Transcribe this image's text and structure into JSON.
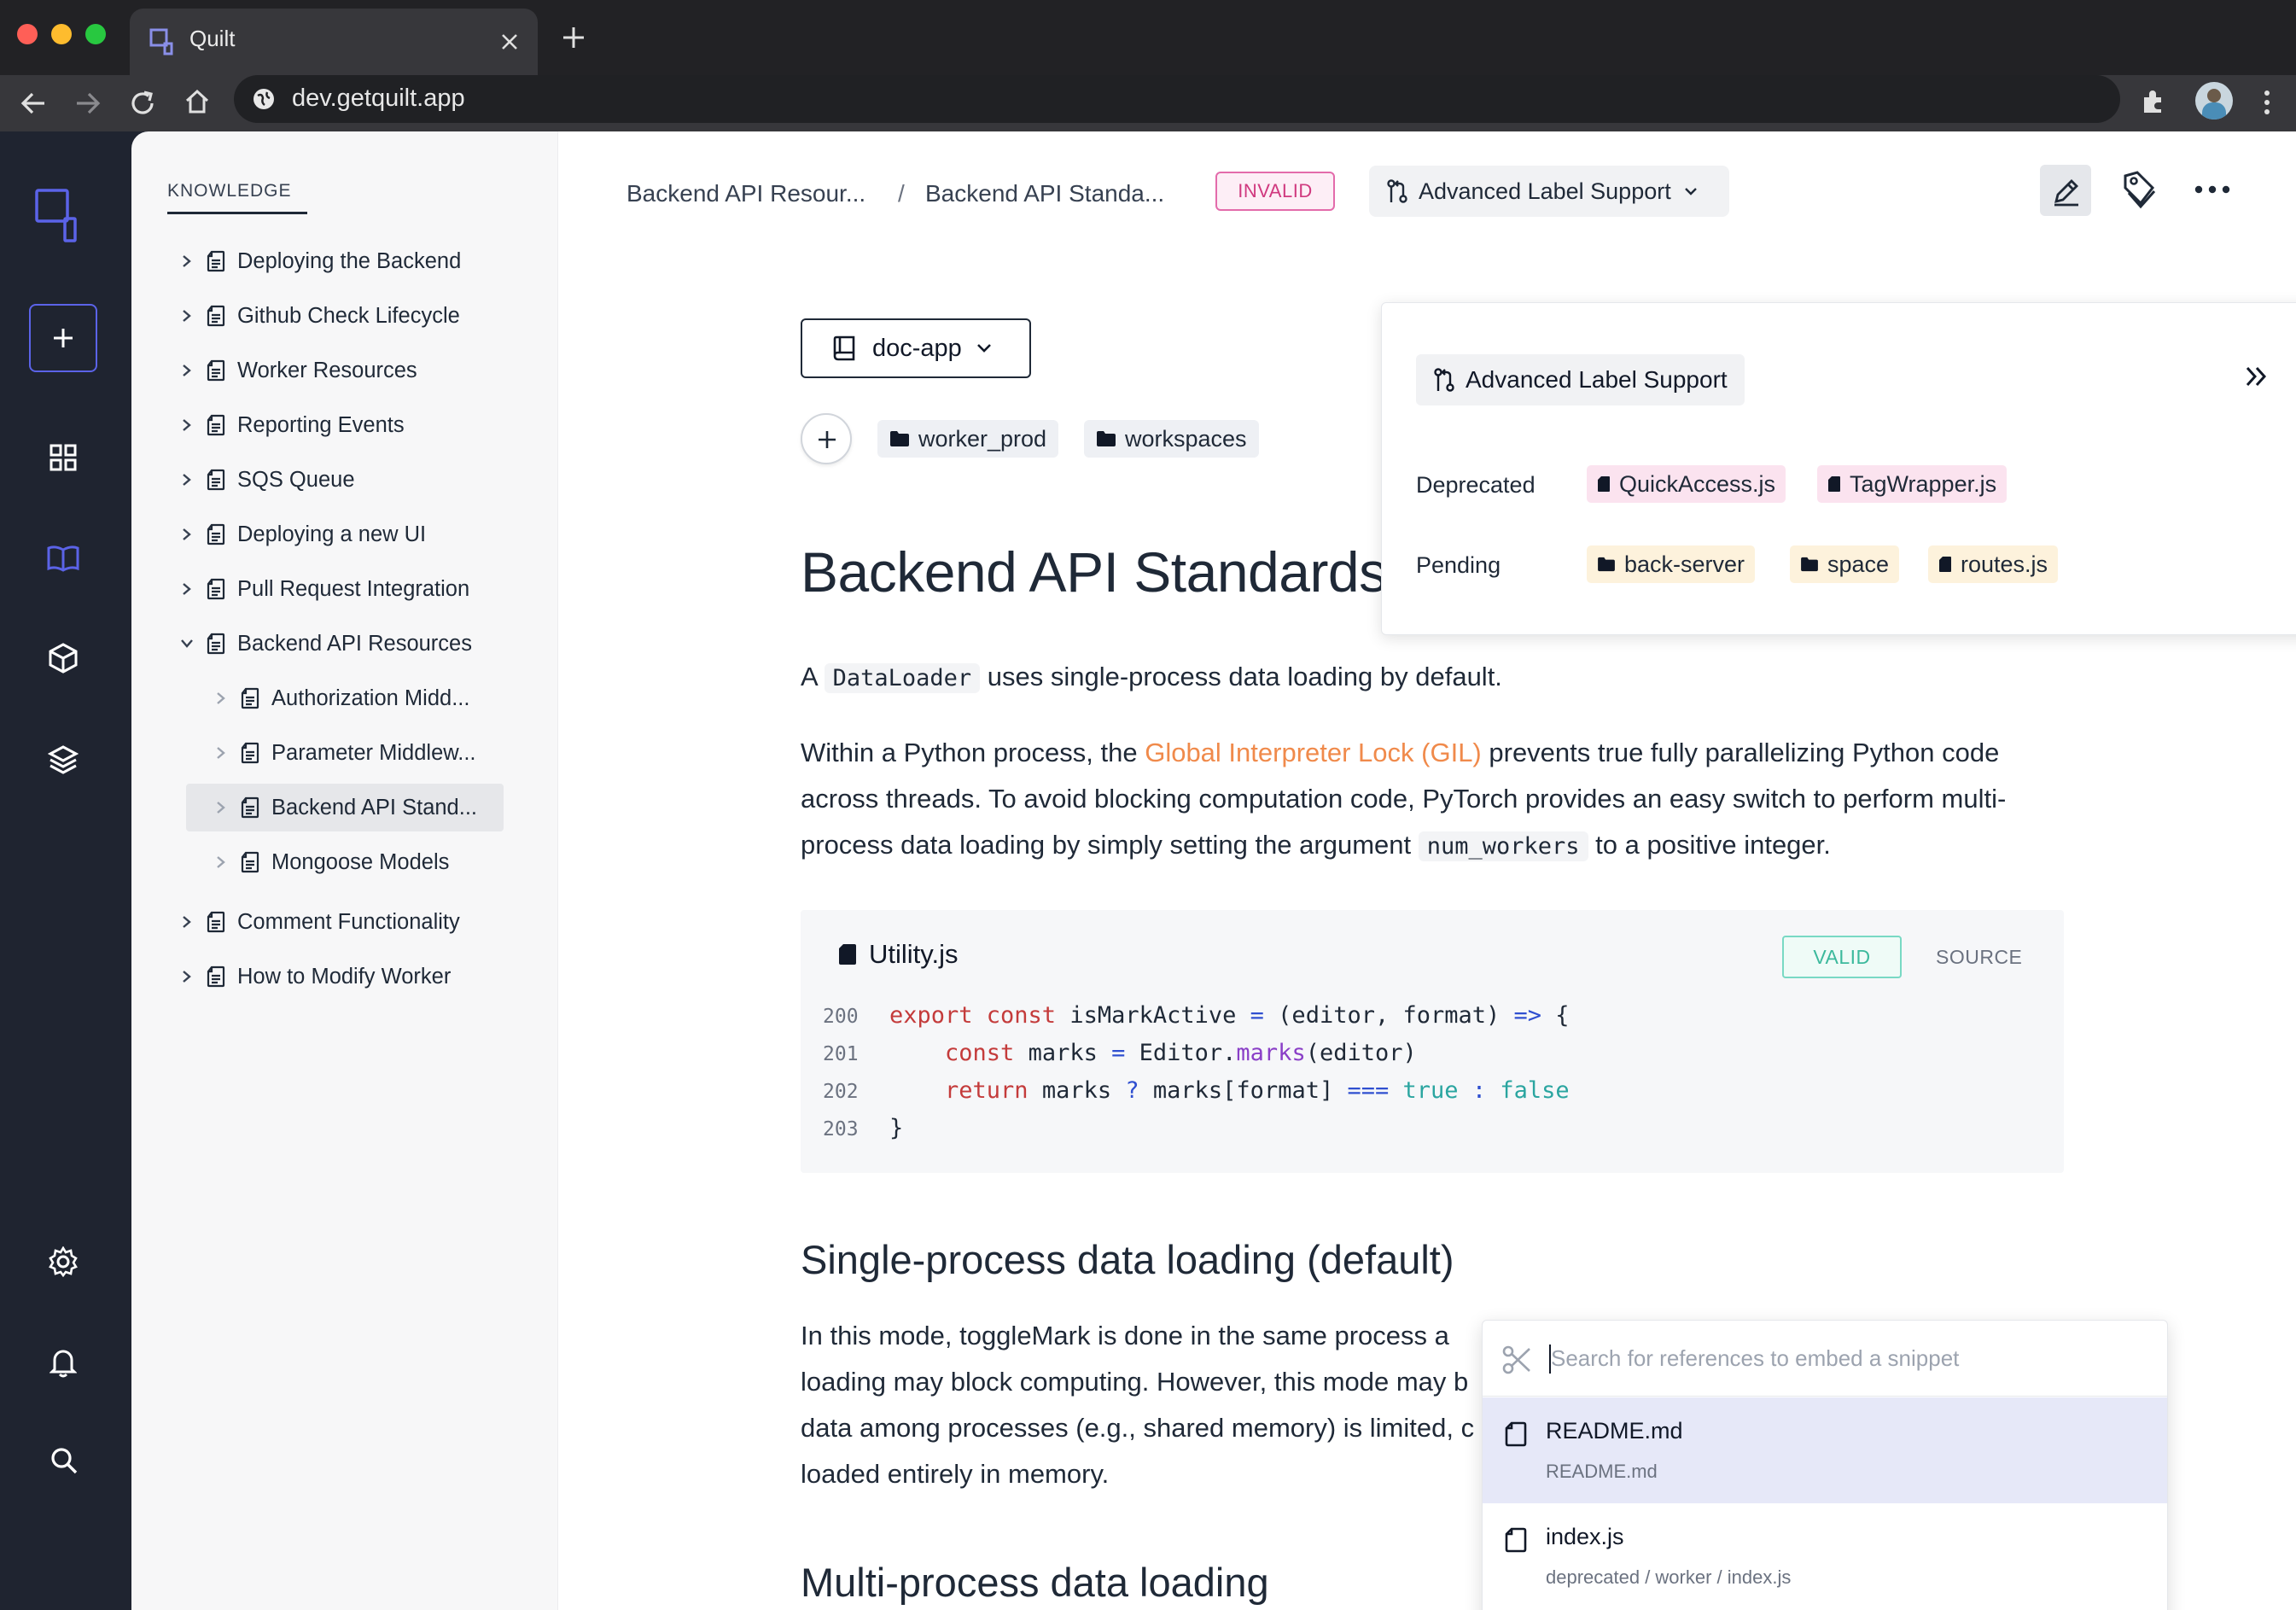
{
  "browser": {
    "tab_title": "Quilt",
    "url": "dev.getquilt.app"
  },
  "sidebar": {
    "section_label": "KNOWLEDGE",
    "items": [
      {
        "label": "Deploying the Backend",
        "level": 0,
        "expanded": false
      },
      {
        "label": "Github Check Lifecycle",
        "level": 0,
        "expanded": false
      },
      {
        "label": "Worker Resources",
        "level": 0,
        "expanded": false
      },
      {
        "label": "Reporting Events",
        "level": 0,
        "expanded": false
      },
      {
        "label": "SQS Queue",
        "level": 0,
        "expanded": false
      },
      {
        "label": "Deploying a new UI",
        "level": 0,
        "expanded": false
      },
      {
        "label": "Pull Request Integration",
        "level": 0,
        "expanded": false
      },
      {
        "label": "Backend API Resources",
        "level": 0,
        "expanded": true
      },
      {
        "label": "Authorization Midd...",
        "level": 1,
        "expanded": false
      },
      {
        "label": "Parameter Middlew...",
        "level": 1,
        "expanded": false
      },
      {
        "label": "Backend API Stand...",
        "level": 1,
        "expanded": false,
        "selected": true
      },
      {
        "label": "Mongoose Models",
        "level": 1,
        "expanded": false
      },
      {
        "label": "Comment Functionality",
        "level": 0,
        "expanded": false
      },
      {
        "label": "How to Modify Worker",
        "level": 0,
        "expanded": false
      }
    ]
  },
  "header": {
    "breadcrumb": [
      "Backend API Resour...",
      "Backend API Standa..."
    ],
    "separator": "/",
    "status_badge": "INVALID",
    "branch": "Advanced Label Support"
  },
  "doc": {
    "repo": "doc-app",
    "folders": [
      "worker_prod",
      "workspaces"
    ],
    "title": "Backend API Standards",
    "para1": {
      "pre": "A ",
      "code": "DataLoader",
      "post": " uses single-process data loading by default."
    },
    "para2": {
      "l1_pre": "Within a Python process, the ",
      "link": "Global Interpreter Lock (GIL)",
      "l1_post": " prevents true fully parallelizing Python code",
      "l2": "across threads. To avoid blocking computation code, PyTorch provides an easy switch to perform multi-",
      "l3_pre": "process data loading by simply setting the argument ",
      "code": "num_workers",
      "l3_post": " to a positive integer."
    },
    "code_block": {
      "filename": "Utility.js",
      "status": "VALID",
      "source_label": "SOURCE",
      "line_numbers": [
        "200",
        "201",
        "202",
        "203"
      ]
    },
    "h2_single": "Single-process data loading (default)",
    "para3": [
      "In this mode, toggleMark is done in the same process a",
      "loading may block computing. However, this mode may b",
      "data among processes (e.g., shared memory) is limited, c",
      "loaded entirely in memory."
    ],
    "h2_multi": "Multi-process data loading"
  },
  "label_popover": {
    "title": "Advanced Label Support",
    "rows": [
      {
        "label": "Deprecated",
        "files": [
          "QuickAccess.js",
          "TagWrapper.js"
        ]
      },
      {
        "label": "Pending",
        "files": [
          "back-server",
          "space",
          "routes.js"
        ]
      }
    ]
  },
  "snippet_search": {
    "placeholder": "Search for references to embed a snippet",
    "results": [
      {
        "name": "README.md",
        "path": "README.md"
      },
      {
        "name": "index.js",
        "path": "deprecated / worker / index.js"
      }
    ]
  },
  "colors": {
    "rail": "#1f2430",
    "accent": "#5b63e8",
    "invalid": "#d0397f",
    "valid": "#3cb99c",
    "link": "#f08a4b"
  }
}
